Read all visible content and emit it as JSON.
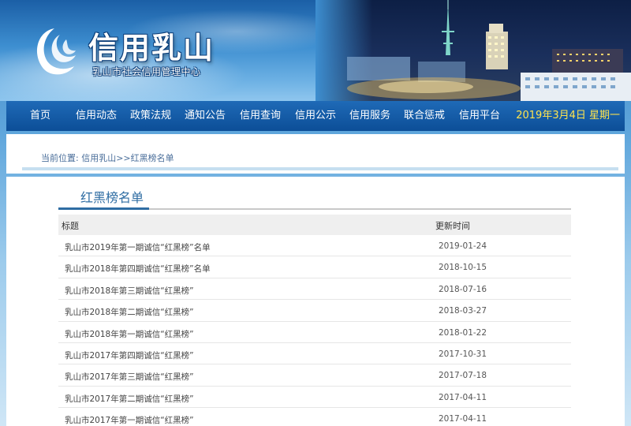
{
  "header": {
    "title": "信用乳山",
    "subtitle": "乳山市社会信用管理中心"
  },
  "nav": {
    "items": [
      "首页",
      "信用动态",
      "政策法规",
      "通知公告",
      "信用查询",
      "信用公示",
      "信用服务",
      "联合惩戒",
      "信用平台"
    ],
    "date": "2019年3月4日  星期一"
  },
  "breadcrumb": {
    "text": "当前位置: 信用乳山>>红黑榜名单"
  },
  "section": {
    "title": "红黑榜名单"
  },
  "table": {
    "headers": {
      "title": "标题",
      "updated": "更新时间"
    },
    "rows": [
      {
        "title": "乳山市2019年第一期诚信“红黑榜”名单",
        "date": "2019-01-24"
      },
      {
        "title": "乳山市2018年第四期诚信“红黑榜”名单",
        "date": "2018-10-15"
      },
      {
        "title": "乳山市2018年第三期诚信“红黑榜”",
        "date": "2018-07-16"
      },
      {
        "title": "乳山市2018年第二期诚信“红黑榜”",
        "date": "2018-03-27"
      },
      {
        "title": "乳山市2018年第一期诚信“红黑榜”",
        "date": "2018-01-22"
      },
      {
        "title": "乳山市2017年第四期诚信“红黑榜”",
        "date": "2017-10-31"
      },
      {
        "title": "乳山市2017年第三期诚信“红黑榜”",
        "date": "2017-07-18"
      },
      {
        "title": "乳山市2017年第二期诚信“红黑榜”",
        "date": "2017-04-11"
      },
      {
        "title": "乳山市2017年第一期诚信“红黑榜”",
        "date": "2017-04-11"
      }
    ]
  },
  "colors": {
    "nav_background": "#0c4e97",
    "nav_date": "#ffe44d",
    "section_accent": "#2f6da3",
    "page_background": "#5fa6dc"
  },
  "icons": {
    "logo": "wave-swirl-logo-icon"
  }
}
